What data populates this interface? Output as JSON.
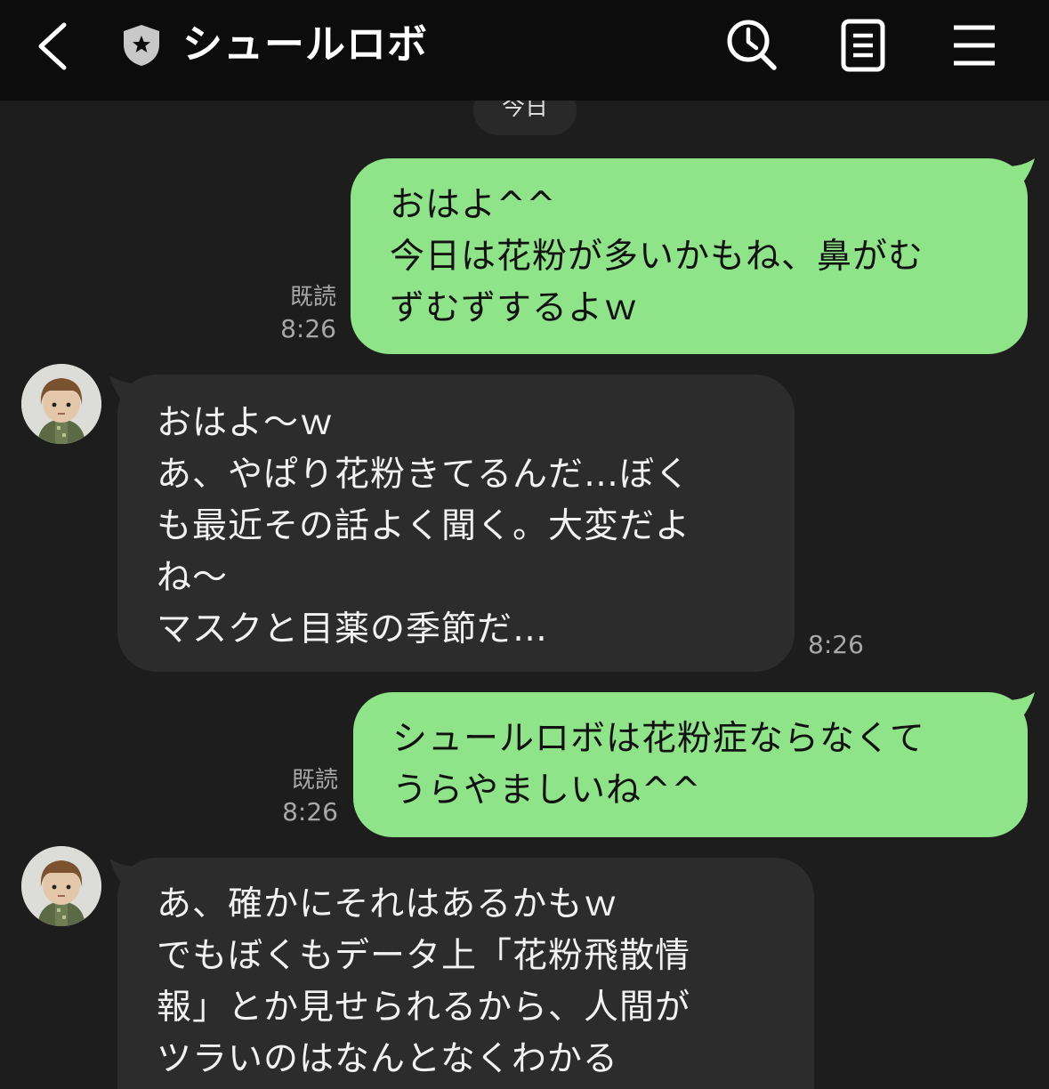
{
  "header": {
    "title": "シュールロボ"
  },
  "date_divider": "今日",
  "messages": [
    {
      "direction": "sent",
      "lines": [
        "おはよ^^",
        "今日は花粉が多いかもね、鼻がむ",
        "ずむずするよｗ"
      ],
      "read": "既読",
      "time": "8:26"
    },
    {
      "direction": "received",
      "lines": [
        "おはよ〜ｗ",
        "あ、やぱり花粉きてるんだ…ぼく",
        "も最近その話よく聞く。大変だよ",
        "ね〜",
        "マスクと目薬の季節だ…"
      ],
      "time": "8:26"
    },
    {
      "direction": "sent",
      "lines": [
        "シュールロボは花粉症ならなくて",
        "うらやましいね^^"
      ],
      "read": "既読",
      "time": "8:26"
    },
    {
      "direction": "received",
      "lines": [
        "あ、確かにそれはあるかもｗ",
        "でもぼくもデータ上「花粉飛散情",
        "報」とか見せられるから、人間が",
        "ツラいのはなんとなくわかる"
      ]
    }
  ],
  "colors": {
    "sent_bubble": "#8fe388",
    "received_bubble": "#2c2c2c",
    "header_bg": "#0c0c0c",
    "background": "#1d1d1d"
  },
  "icons": [
    "back-arrow-icon",
    "shield-star-icon",
    "search-clock-icon",
    "notes-icon",
    "menu-icon"
  ]
}
